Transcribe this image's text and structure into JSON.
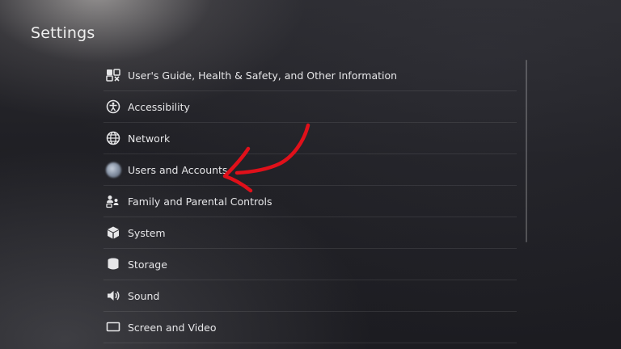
{
  "header": {
    "title": "Settings"
  },
  "menu": {
    "items": [
      {
        "label": "User's Guide, Health & Safety, and Other Information",
        "icon": "guide-icon"
      },
      {
        "label": "Accessibility",
        "icon": "accessibility-icon"
      },
      {
        "label": "Network",
        "icon": "globe-icon"
      },
      {
        "label": "Users and Accounts",
        "icon": "avatar-icon"
      },
      {
        "label": "Family and Parental Controls",
        "icon": "family-icon"
      },
      {
        "label": "System",
        "icon": "cube-icon"
      },
      {
        "label": "Storage",
        "icon": "storage-icon"
      },
      {
        "label": "Sound",
        "icon": "speaker-icon"
      },
      {
        "label": "Screen and Video",
        "icon": "screen-icon"
      }
    ]
  },
  "annotation": {
    "icon": "red-arrow-icon",
    "color": "#e0101a"
  },
  "colors": {
    "text": "#e6e6e8",
    "background": "#1f1f24"
  }
}
